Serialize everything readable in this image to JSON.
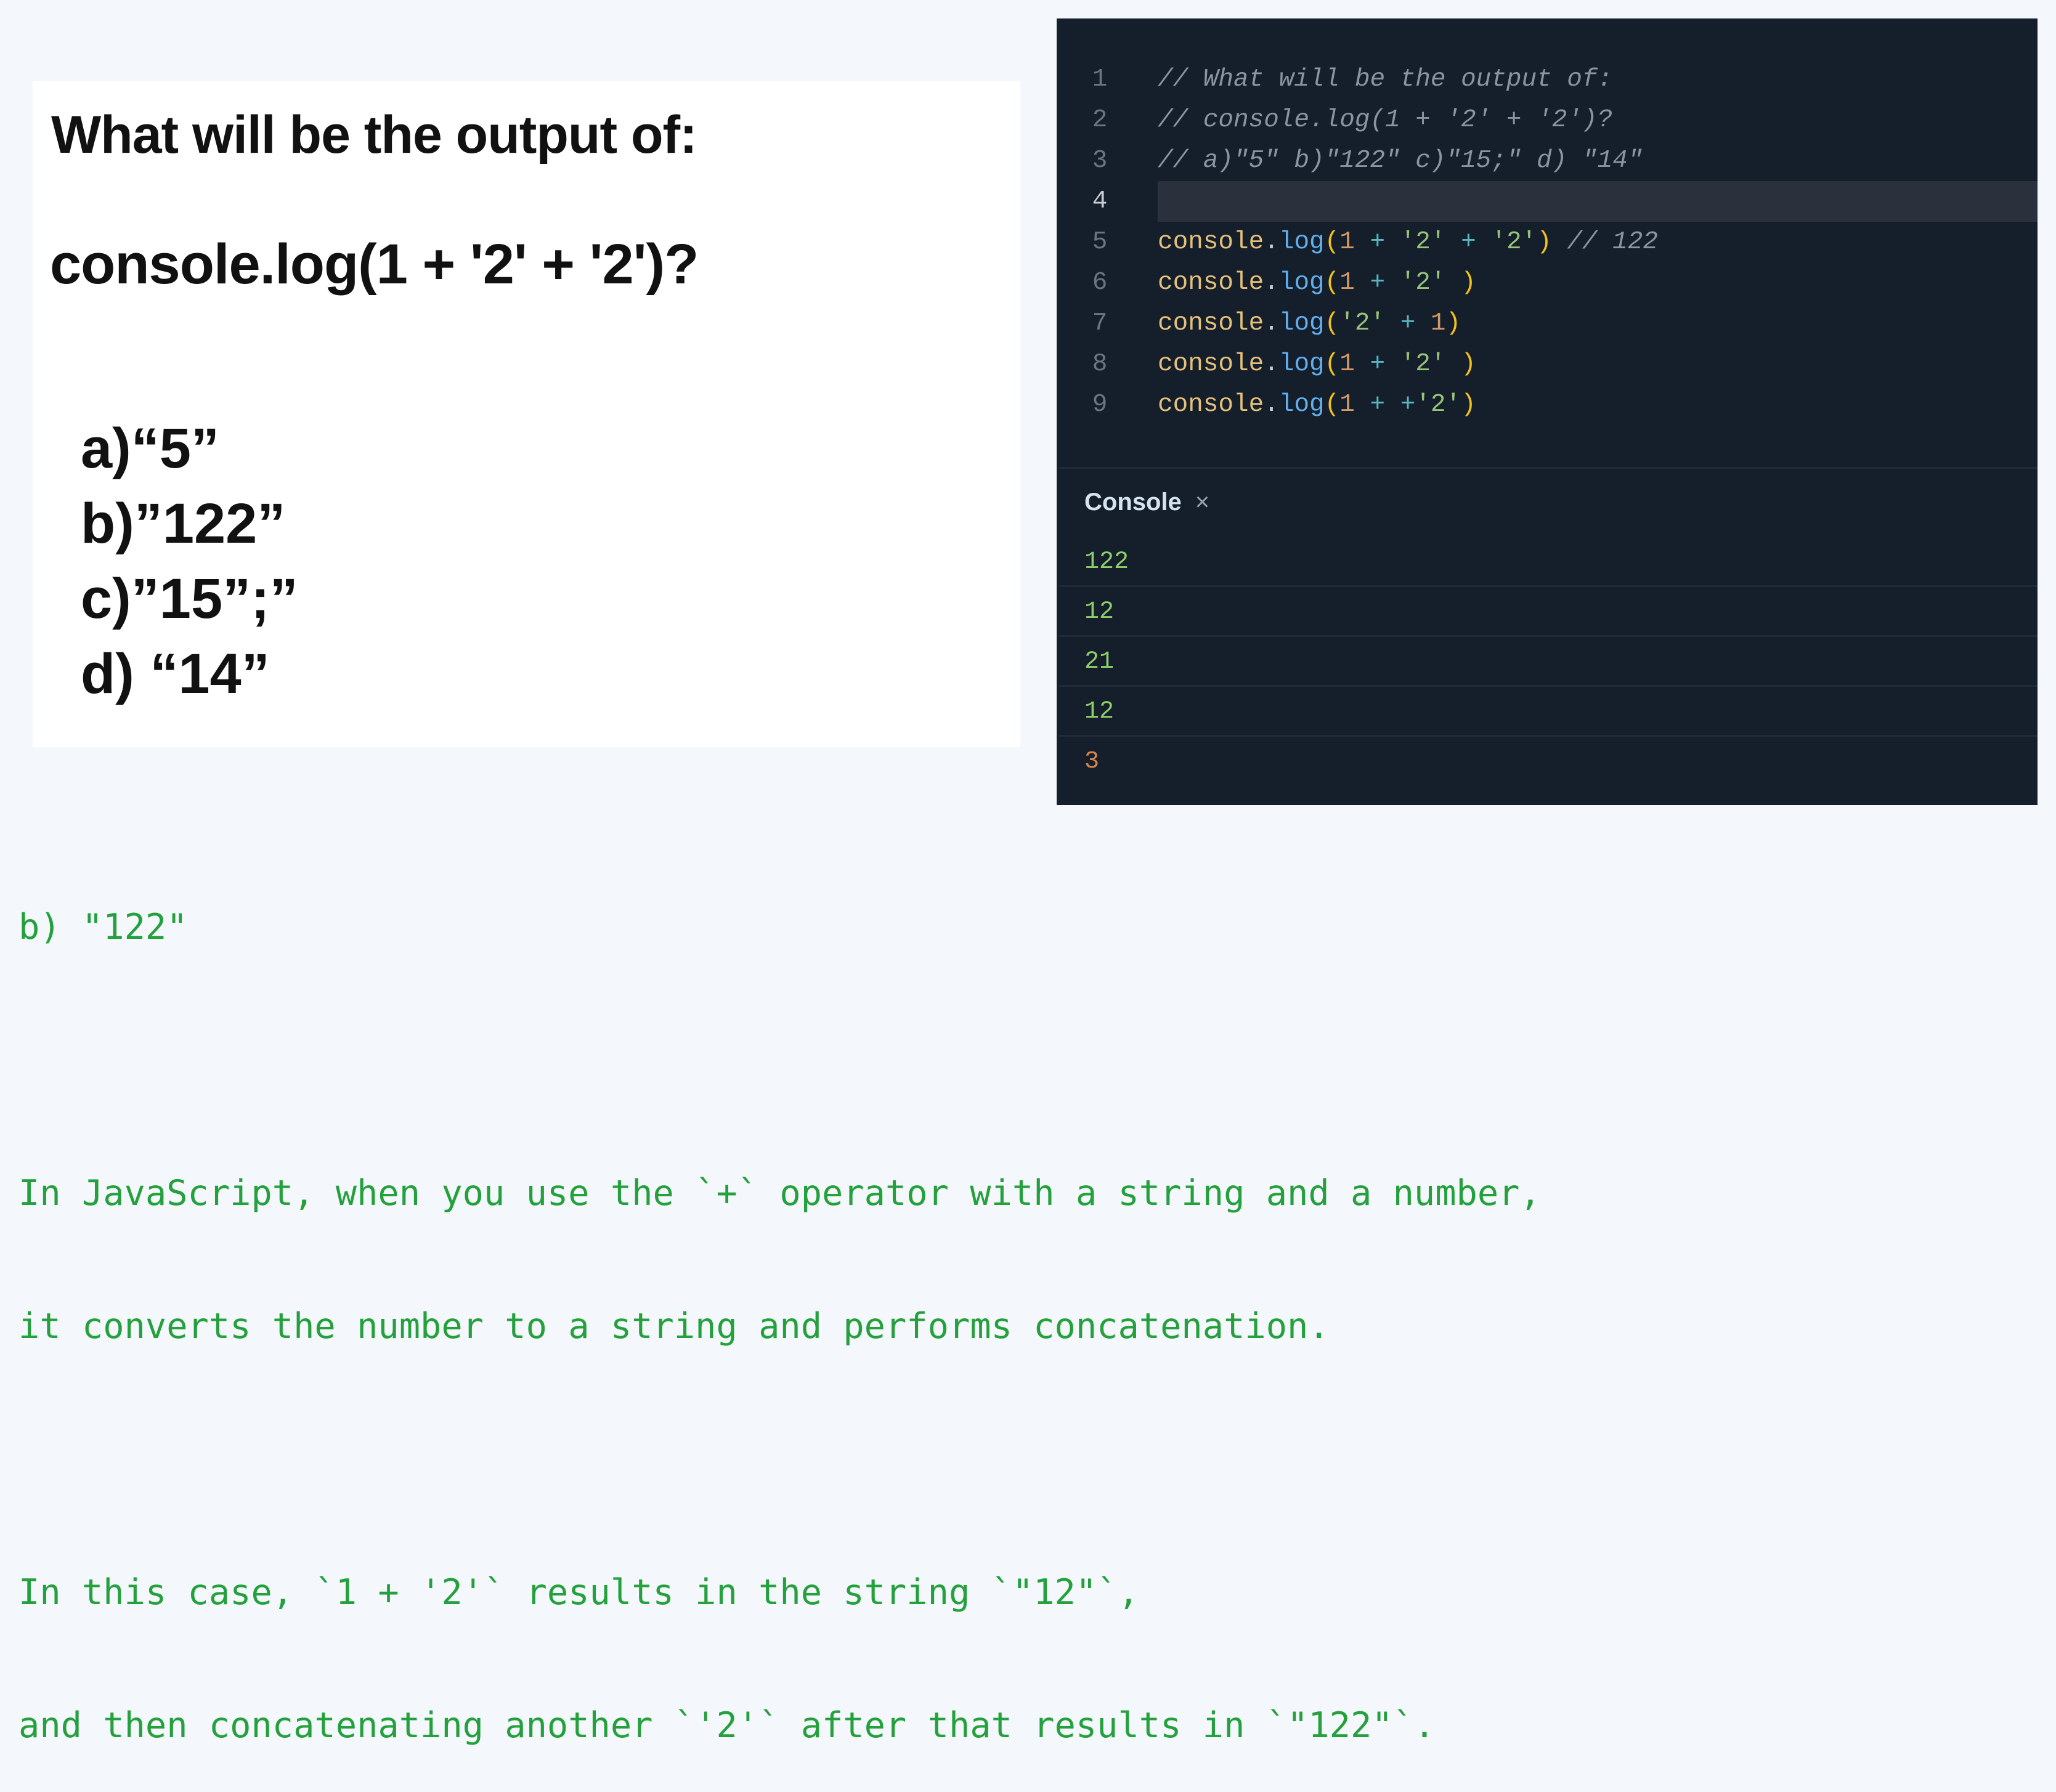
{
  "question_card": {
    "title": "What will be the output of:",
    "code": "console.log(1 + '2' + '2')?",
    "options": [
      "a)“5”",
      "b)”122”",
      "c)”15”;”",
      "d) “14”"
    ]
  },
  "editor": {
    "active_line": 4,
    "lines": [
      {
        "n": "1",
        "tokens": [
          {
            "t": "comment",
            "v": "// What will be the output of:"
          }
        ]
      },
      {
        "n": "2",
        "tokens": [
          {
            "t": "comment",
            "v": "// console.log(1 + '2' + '2')?"
          }
        ]
      },
      {
        "n": "3",
        "tokens": [
          {
            "t": "comment",
            "v": "// a)\"5\" b)\"122\" c)\"15;\" d) \"14\""
          }
        ]
      },
      {
        "n": "4",
        "tokens": []
      },
      {
        "n": "5",
        "tokens": [
          {
            "t": "obj",
            "v": "console"
          },
          {
            "t": "dot",
            "v": "."
          },
          {
            "t": "fn",
            "v": "log"
          },
          {
            "t": "paren",
            "v": "("
          },
          {
            "t": "num",
            "v": "1"
          },
          {
            "t": "sp",
            "v": " "
          },
          {
            "t": "op",
            "v": "+"
          },
          {
            "t": "sp",
            "v": " "
          },
          {
            "t": "str",
            "v": "'2'"
          },
          {
            "t": "sp",
            "v": " "
          },
          {
            "t": "op",
            "v": "+"
          },
          {
            "t": "sp",
            "v": " "
          },
          {
            "t": "str",
            "v": "'2'"
          },
          {
            "t": "paren",
            "v": ")"
          },
          {
            "t": "sp",
            "v": " "
          },
          {
            "t": "comment",
            "v": "// 122"
          }
        ]
      },
      {
        "n": "6",
        "tokens": [
          {
            "t": "obj",
            "v": "console"
          },
          {
            "t": "dot",
            "v": "."
          },
          {
            "t": "fn",
            "v": "log"
          },
          {
            "t": "paren",
            "v": "("
          },
          {
            "t": "num",
            "v": "1"
          },
          {
            "t": "sp",
            "v": " "
          },
          {
            "t": "op",
            "v": "+"
          },
          {
            "t": "sp",
            "v": " "
          },
          {
            "t": "str",
            "v": "'2'"
          },
          {
            "t": "sp",
            "v": " "
          },
          {
            "t": "paren",
            "v": ")"
          }
        ]
      },
      {
        "n": "7",
        "tokens": [
          {
            "t": "obj",
            "v": "console"
          },
          {
            "t": "dot",
            "v": "."
          },
          {
            "t": "fn",
            "v": "log"
          },
          {
            "t": "paren",
            "v": "("
          },
          {
            "t": "str",
            "v": "'2'"
          },
          {
            "t": "sp",
            "v": " "
          },
          {
            "t": "op",
            "v": "+"
          },
          {
            "t": "sp",
            "v": " "
          },
          {
            "t": "num",
            "v": "1"
          },
          {
            "t": "paren",
            "v": ")"
          }
        ]
      },
      {
        "n": "8",
        "tokens": [
          {
            "t": "obj",
            "v": "console"
          },
          {
            "t": "dot",
            "v": "."
          },
          {
            "t": "fn",
            "v": "log"
          },
          {
            "t": "paren",
            "v": "("
          },
          {
            "t": "num",
            "v": "1"
          },
          {
            "t": "sp",
            "v": " "
          },
          {
            "t": "op",
            "v": "+"
          },
          {
            "t": "sp",
            "v": " "
          },
          {
            "t": "str",
            "v": "'2'"
          },
          {
            "t": "sp",
            "v": " "
          },
          {
            "t": "paren",
            "v": ")"
          }
        ]
      },
      {
        "n": "9",
        "tokens": [
          {
            "t": "obj",
            "v": "console"
          },
          {
            "t": "dot",
            "v": "."
          },
          {
            "t": "fn",
            "v": "log"
          },
          {
            "t": "paren",
            "v": "("
          },
          {
            "t": "num",
            "v": "1"
          },
          {
            "t": "sp",
            "v": " "
          },
          {
            "t": "op",
            "v": "+"
          },
          {
            "t": "sp",
            "v": " "
          },
          {
            "t": "op",
            "v": "+"
          },
          {
            "t": "str",
            "v": "'2'"
          },
          {
            "t": "paren",
            "v": ")"
          }
        ]
      }
    ]
  },
  "console": {
    "tab_label": "Console",
    "close_icon": "×",
    "outputs": [
      {
        "value": "122",
        "kind": "string"
      },
      {
        "value": "12",
        "kind": "string"
      },
      {
        "value": "21",
        "kind": "string"
      },
      {
        "value": "12",
        "kind": "string"
      },
      {
        "value": "3",
        "kind": "number"
      }
    ]
  },
  "answer": {
    "result": "b) \"122\"",
    "paragraph1": [
      "In JavaScript, when you use the `+` operator with a string and a number,",
      "it converts the number to a string and performs concatenation."
    ],
    "paragraph2": [
      "In this case, `1 + '2'` results in the string `\"12\"`,",
      "and then concatenating another `'2'` after that results in `\"122\"`."
    ]
  },
  "colors": {
    "background": "#f4f8fc",
    "editor_bg": "#151f2c",
    "answer_text": "#24a03c",
    "console_string": "#8fcf6a",
    "console_number": "#d8874a"
  }
}
